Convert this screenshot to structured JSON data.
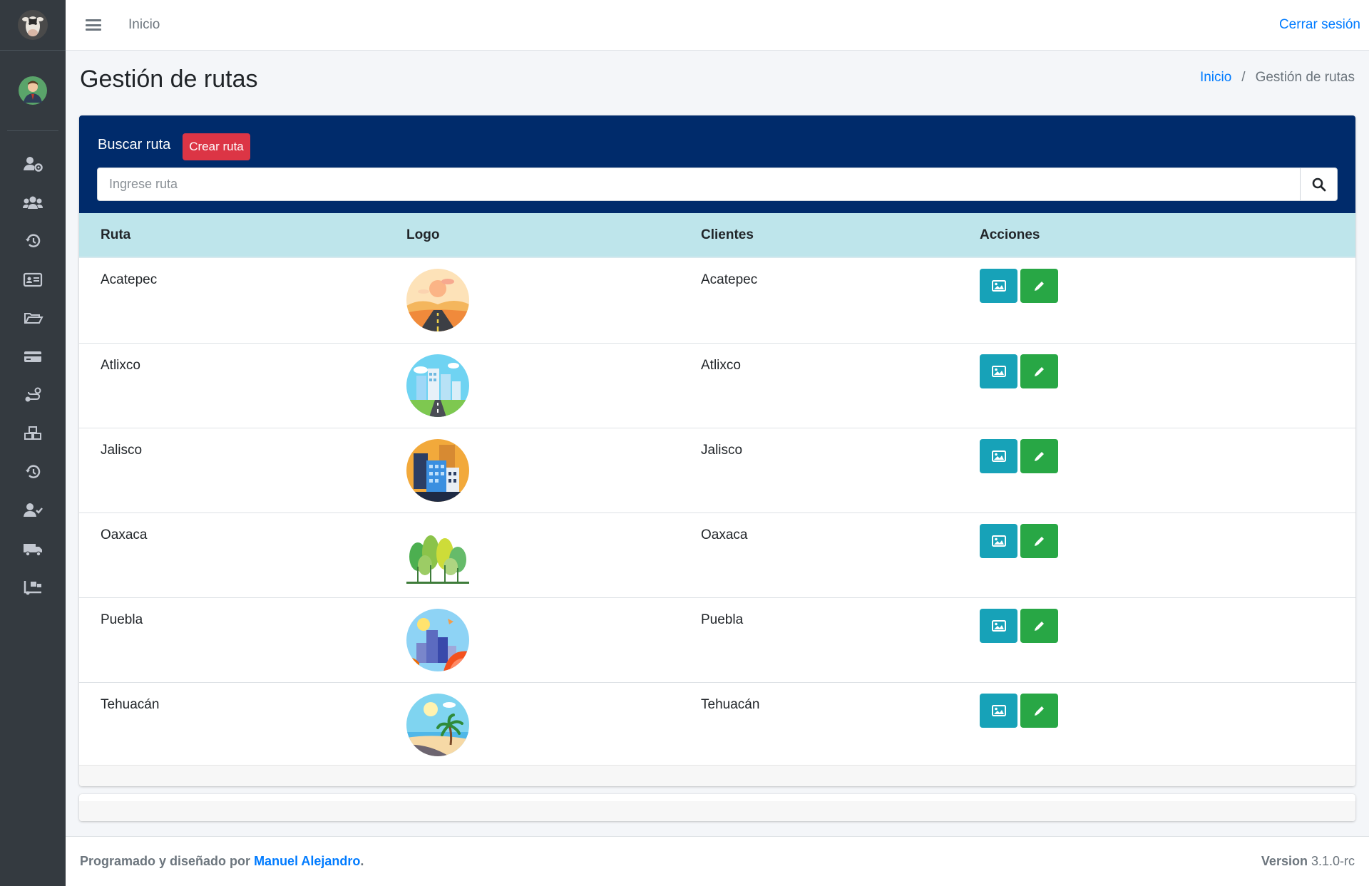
{
  "topbar": {
    "home_label": "Inicio",
    "logout_label": "Cerrar sesión"
  },
  "page": {
    "title": "Gestión de rutas"
  },
  "breadcrumb": {
    "home": "Inicio",
    "separator": "/",
    "current": "Gestión de rutas"
  },
  "card": {
    "title": "Buscar ruta",
    "create_button": "Crear ruta",
    "search_placeholder": "Ingrese ruta"
  },
  "table": {
    "headers": [
      "Ruta",
      "Logo",
      "Clientes",
      "Acciones"
    ],
    "rows": [
      {
        "ruta": "Acatepec",
        "logo": "road-sunset-illustration",
        "clientes": "Acatepec"
      },
      {
        "ruta": "Atlixco",
        "logo": "city-road-illustration",
        "clientes": "Atlixco"
      },
      {
        "ruta": "Jalisco",
        "logo": "buildings-illustration",
        "clientes": "Jalisco"
      },
      {
        "ruta": "Oaxaca",
        "logo": "trees-illustration",
        "clientes": "Oaxaca"
      },
      {
        "ruta": "Puebla",
        "logo": "city-volcano-illustration",
        "clientes": "Puebla"
      },
      {
        "ruta": "Tehuacán",
        "logo": "beach-palm-illustration",
        "clientes": "Tehuacán"
      }
    ]
  },
  "sidebar": {
    "icons": [
      "users-cog-icon",
      "users-icon",
      "history-icon",
      "id-card-icon",
      "folder-open-icon",
      "credit-card-icon",
      "route-icon",
      "boxes-icon",
      "history-icon",
      "user-check-icon",
      "truck-icon",
      "truck-loading-icon"
    ]
  },
  "footer": {
    "prefix": "Programado y diseñado por",
    "author": "Manuel Alejandro",
    "suffix": ".",
    "version_label": "Version",
    "version_value": "3.1.0-rc"
  },
  "colors": {
    "sidebar": "#343a40",
    "card_header": "#002b6b",
    "table_header": "#bee5eb",
    "danger": "#dc3545",
    "info": "#17a2b8",
    "success": "#28a745",
    "link": "#007bff"
  }
}
